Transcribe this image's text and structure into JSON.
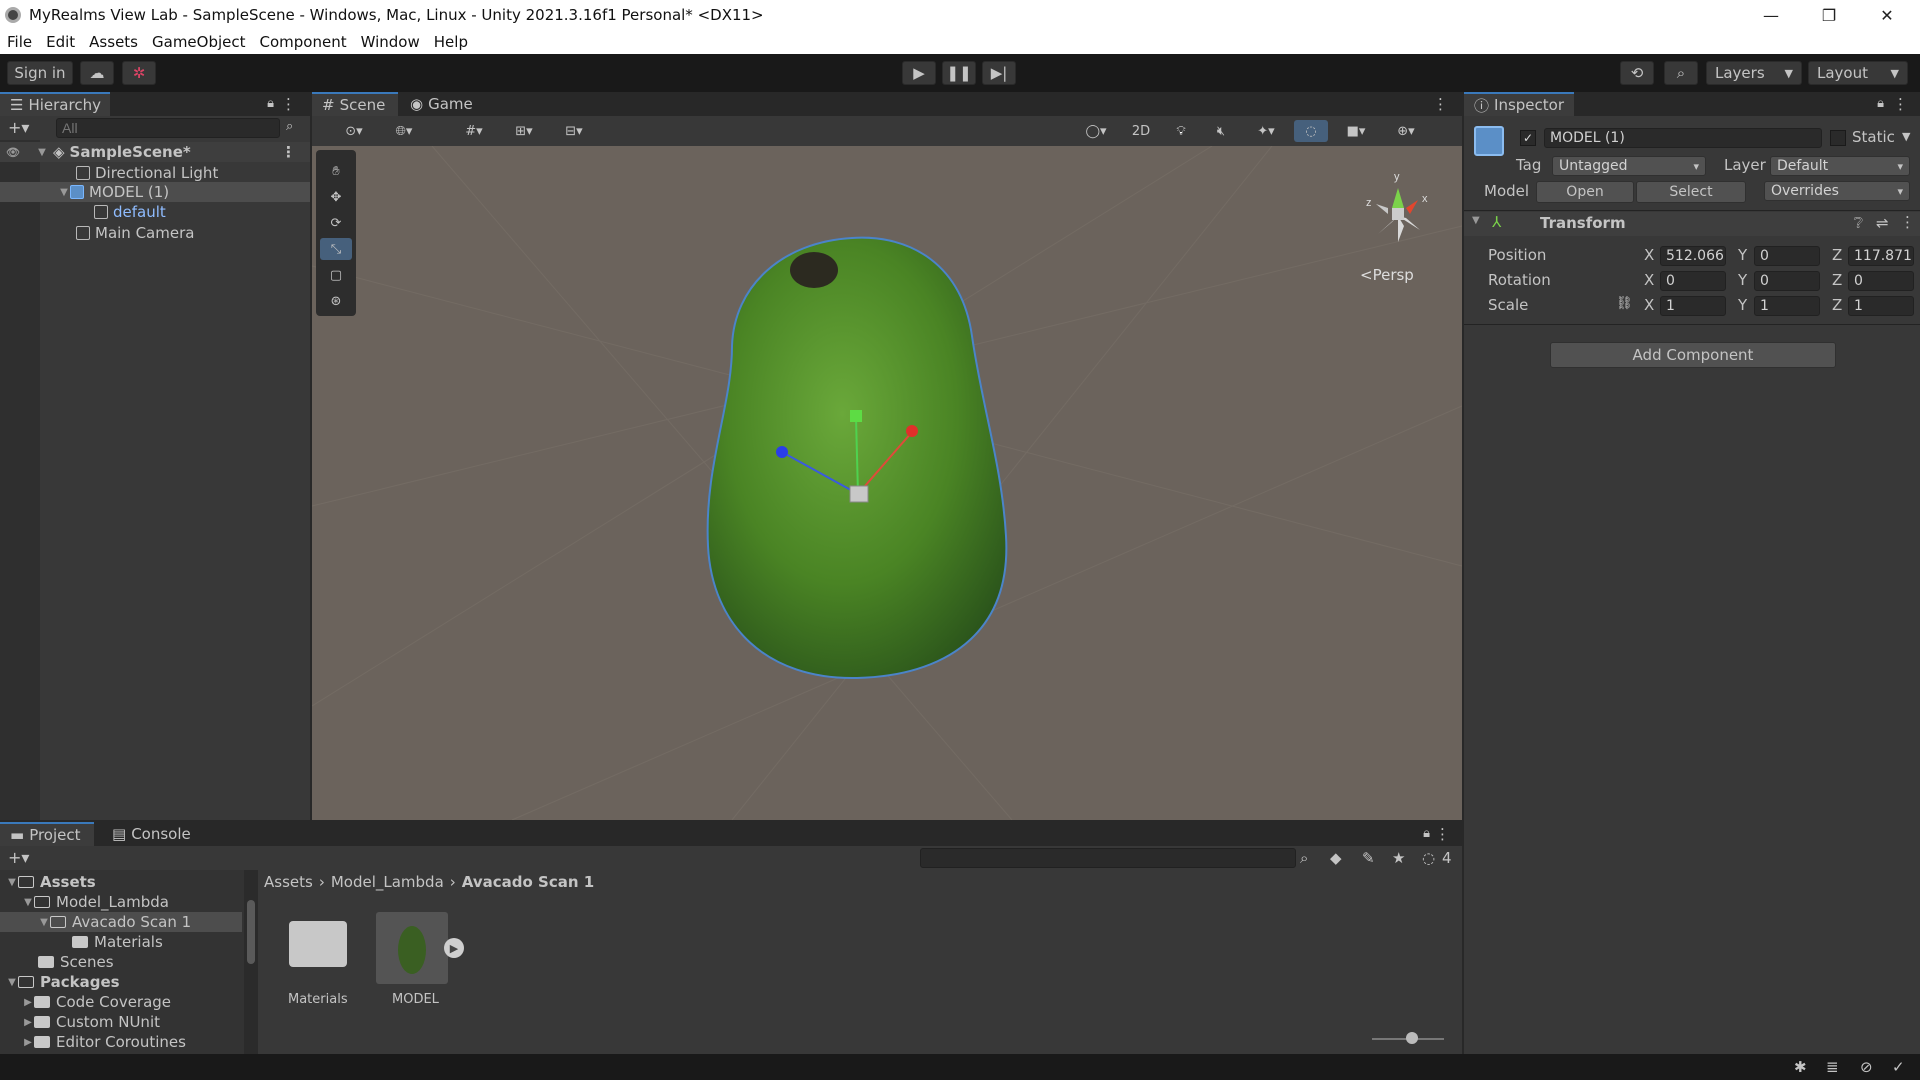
{
  "window": {
    "title": "MyRealms View Lab - SampleScene - Windows, Mac, Linux - Unity 2021.3.16f1 Personal* <DX11>",
    "minimize": "—",
    "restore": "❐",
    "close": "✕"
  },
  "menu": [
    "File",
    "Edit",
    "Assets",
    "GameObject",
    "Component",
    "Window",
    "Help"
  ],
  "toolbar": {
    "sign_in": "Sign in",
    "layers": "Layers",
    "layout": "Layout"
  },
  "hierarchy": {
    "tab": "Hierarchy",
    "search_placeholder": "All",
    "scene": "SampleScene*",
    "items": [
      "Directional Light",
      "MODEL (1)",
      "default",
      "Main Camera"
    ]
  },
  "scene_view": {
    "tab_scene": "Scene",
    "tab_game": "Game",
    "mode_2d": "2D",
    "persp": "Persp",
    "gizmo_axes": {
      "x": "x",
      "y": "y",
      "z": "z"
    }
  },
  "inspector": {
    "tab": "Inspector",
    "object_name": "MODEL (1)",
    "static_label": "Static",
    "tag_label": "Tag",
    "tag_value": "Untagged",
    "layer_label": "Layer",
    "layer_value": "Default",
    "model_label": "Model",
    "open": "Open",
    "select": "Select",
    "overrides": "Overrides",
    "component": "Transform",
    "position_label": "Position",
    "rotation_label": "Rotation",
    "scale_label": "Scale",
    "position": {
      "x": "512.066",
      "y": "0",
      "z": "117.871"
    },
    "rotation": {
      "x": "0",
      "y": "0",
      "z": "0"
    },
    "scale": {
      "x": "1",
      "y": "1",
      "z": "1"
    },
    "axis": {
      "x": "X",
      "y": "Y",
      "z": "Z"
    },
    "add_component": "Add Component"
  },
  "project": {
    "tab_project": "Project",
    "tab_console": "Console",
    "hidden_count": "4",
    "tree": {
      "assets": "Assets",
      "model_lambda": "Model_Lambda",
      "avacado": "Avacado Scan 1",
      "materials": "Materials",
      "scenes": "Scenes",
      "packages": "Packages",
      "code_coverage": "Code Coverage",
      "custom_nunit": "Custom NUnit",
      "editor_coroutines": "Editor Coroutines"
    },
    "breadcrumb": [
      "Assets",
      "Model_Lambda",
      "Avacado Scan 1"
    ],
    "assets": [
      {
        "label": "Materials"
      },
      {
        "label": "MODEL"
      }
    ]
  },
  "colors": {
    "accent": "#3a79bb",
    "bg_scene": "#6b635c",
    "avocado": "#4f8a2a"
  }
}
